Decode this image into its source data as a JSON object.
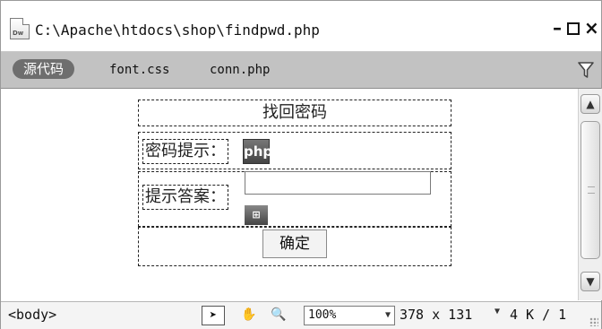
{
  "window": {
    "title": "C:\\Apache\\htdocs\\shop\\findpwd.php",
    "minimize": "–",
    "close": "×"
  },
  "tabs": [
    {
      "label": "源代码",
      "active": true
    },
    {
      "label": "font.css",
      "active": false
    },
    {
      "label": "conn.php",
      "active": false
    }
  ],
  "design": {
    "heading": "找回密码",
    "row1_label": "密码提示：",
    "row2_label": "提示答案：",
    "php_icon": "php",
    "small_icon": "⊞",
    "answer_value": "",
    "submit_label": "确定"
  },
  "statusbar": {
    "tag_selector": "<body>",
    "zoom": "100%",
    "window_size": "378 x 131",
    "file_size": "4 K / 1"
  },
  "icons": [
    "dreamweaver-doc-icon",
    "filter-icon",
    "pointer-tool-icon",
    "hand-tool-icon",
    "zoom-tool-icon",
    "scroll-up-icon",
    "scroll-down-icon",
    "resize-grip-icon"
  ]
}
